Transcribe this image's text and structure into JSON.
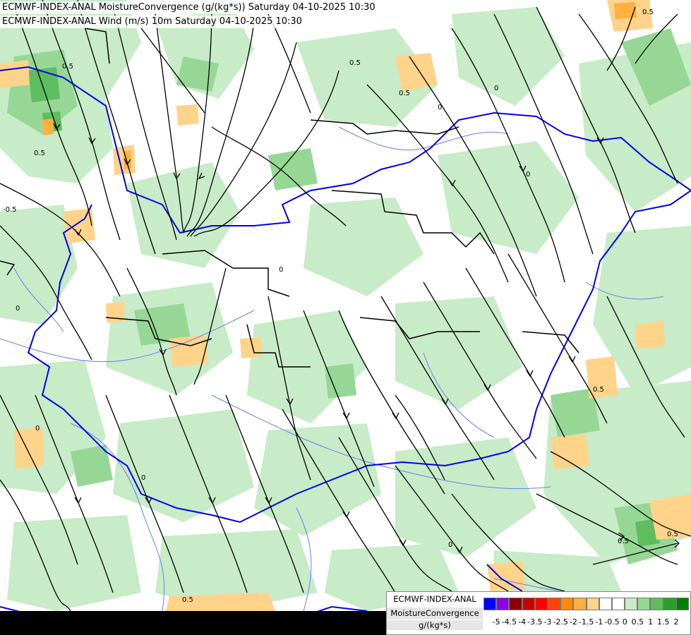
{
  "header": {
    "line1": "ECMWF-INDEX-ANAL MoistureConvergence (g/(kg*s)) Saturday 04-10-2025 10:30",
    "line2": "ECMWF-INDEX-ANAL Wind (m/s) 10m Saturday 04-10-2025 10:30"
  },
  "legend": {
    "model": "ECMWF-INDEX-ANAL",
    "parameter": "MoistureConvergence",
    "unit": "g/(kg*s)",
    "ticks": [
      "-5",
      "-4.5",
      "-4",
      "-3.5",
      "-3",
      "-2.5",
      "-2",
      "-1.5",
      "-1",
      "-0.5",
      "0",
      "0.5",
      "1",
      "1.5",
      "2"
    ],
    "colors": [
      "#0000ff",
      "#8a00e6",
      "#8b0000",
      "#c80000",
      "#ff0000",
      "#ff4500",
      "#ff8c00",
      "#ffb040",
      "#ffd38a",
      "#ffffff",
      "#ffffff",
      "#c8ebc8",
      "#96d796",
      "#5ebd5e",
      "#2aa02a",
      "#008000"
    ]
  },
  "contour_labels": [
    "0",
    "0.5",
    "-0.5"
  ],
  "colors": {
    "background": "#ffffff",
    "light_green": "#c8ebc8",
    "mid_green": "#96d796",
    "dark_green": "#5ebd5e",
    "orange_light": "#ffd38a",
    "orange": "#ffb040",
    "border": "#0000ee",
    "river": "#6b7ff0",
    "streamline": "#000000"
  }
}
